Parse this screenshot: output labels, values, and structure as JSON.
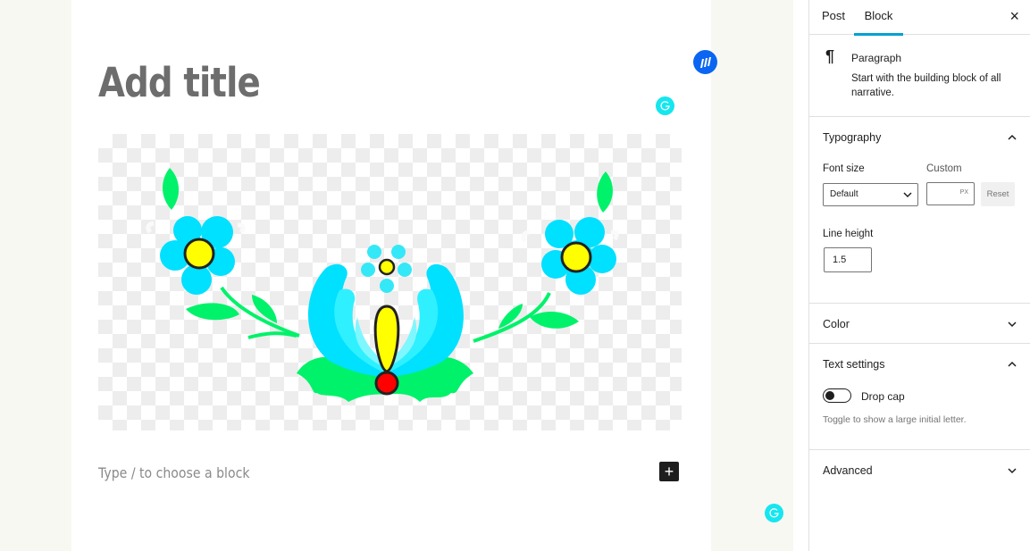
{
  "editor": {
    "title_placeholder": "Add title",
    "image_alt": "Folk floral illustration with blue flowers, green leaves and a central tulip on a transparent background",
    "paragraph_placeholder": "Type / to choose a block",
    "add_block_label": "+"
  },
  "floating_badges": [
    {
      "name": "writing-assistant-badge",
      "color": "#0a66f2"
    },
    {
      "name": "grammarly-badge",
      "color": "#15e6ef"
    },
    {
      "name": "grammarly-badge-bottom",
      "color": "#15e6ef"
    }
  ],
  "sidebar": {
    "tabs": [
      {
        "label": "Post",
        "active": false
      },
      {
        "label": "Block",
        "active": true
      }
    ],
    "close_label": "×",
    "block": {
      "icon": "¶",
      "name": "Paragraph",
      "description": "Start with the building block of all narrative."
    },
    "typography": {
      "title": "Typography",
      "expanded": true,
      "font_size_label": "Font size",
      "font_size_value": "Default",
      "custom_label": "Custom",
      "custom_value": "",
      "custom_unit": "PX",
      "reset_label": "Reset",
      "line_height_label": "Line height",
      "line_height_value": "1.5"
    },
    "color": {
      "title": "Color",
      "expanded": false
    },
    "text_settings": {
      "title": "Text settings",
      "expanded": true,
      "drop_cap_label": "Drop cap",
      "drop_cap_enabled": false,
      "drop_cap_help": "Toggle to show a large initial letter."
    },
    "advanced": {
      "title": "Advanced",
      "expanded": false
    }
  },
  "colors": {
    "accent": "#00a0d2",
    "petal_blue": "#00e0ff",
    "leaf_green": "#00f26a",
    "center_yellow": "#ffff00",
    "berry_red": "#ff0000"
  }
}
